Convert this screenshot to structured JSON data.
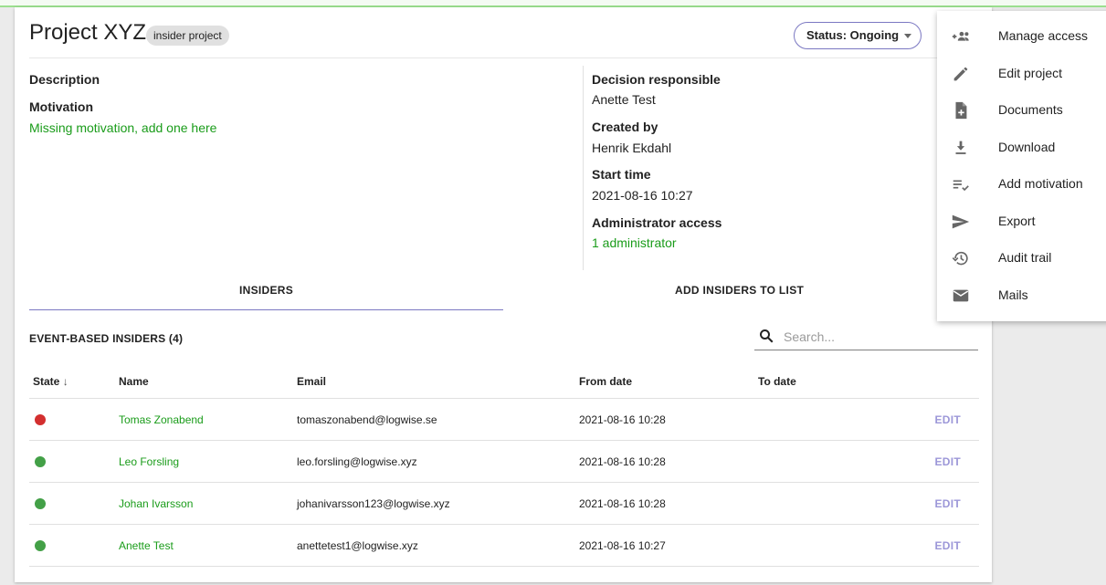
{
  "project": {
    "title": "Project XYZ",
    "chip": "insider project",
    "status_label": "Status: Ongoing"
  },
  "details": {
    "description_label": "Description",
    "motivation_label": "Motivation",
    "motivation_value": "Missing motivation, add one here",
    "decision_label": "Decision responsible",
    "decision_value": "Anette Test",
    "created_label": "Created by",
    "created_value": "Henrik Ekdahl",
    "start_label": "Start time",
    "start_value": "2021-08-16 10:27",
    "admin_label": "Administrator access",
    "admin_value": "1 administrator"
  },
  "tabs": [
    "INSIDERS",
    "ADD INSIDERS TO LIST"
  ],
  "section_title": "EVENT-BASED INSIDERS (4)",
  "search": {
    "placeholder": "Search..."
  },
  "table": {
    "columns": [
      "State",
      "Name",
      "Email",
      "From date",
      "To date"
    ],
    "sort_indicator": "↓",
    "rows": [
      {
        "state": "red",
        "name": "Tomas Zonabend",
        "email": "tomaszonabend@logwise.se",
        "from": "2021-08-16 10:28",
        "to": "",
        "action": "EDIT"
      },
      {
        "state": "green",
        "name": "Leo Forsling",
        "email": "leo.forsling@logwise.xyz",
        "from": "2021-08-16 10:28",
        "to": "",
        "action": "EDIT"
      },
      {
        "state": "green",
        "name": "Johan Ivarsson",
        "email": "johanivarsson123@logwise.xyz",
        "from": "2021-08-16 10:28",
        "to": "",
        "action": "EDIT"
      },
      {
        "state": "green",
        "name": "Anette Test",
        "email": "anettetest1@logwise.xyz",
        "from": "2021-08-16 10:27",
        "to": "",
        "action": "EDIT"
      }
    ]
  },
  "menu": {
    "items": [
      {
        "label": "Manage access",
        "icon": "group-add-icon"
      },
      {
        "label": "Edit project",
        "icon": "pencil-icon"
      },
      {
        "label": "Documents",
        "icon": "document-add-icon"
      },
      {
        "label": "Download",
        "icon": "download-icon"
      },
      {
        "label": "Add motivation",
        "icon": "playlist-check-icon"
      },
      {
        "label": "Export",
        "icon": "send-icon"
      },
      {
        "label": "Audit trail",
        "icon": "history-icon"
      },
      {
        "label": "Mails",
        "icon": "mail-icon"
      }
    ]
  },
  "colors": {
    "accent": "#7b78c2",
    "link_green": "#1a9c1a",
    "state_red": "#d32f2f",
    "state_green": "#43a047"
  }
}
